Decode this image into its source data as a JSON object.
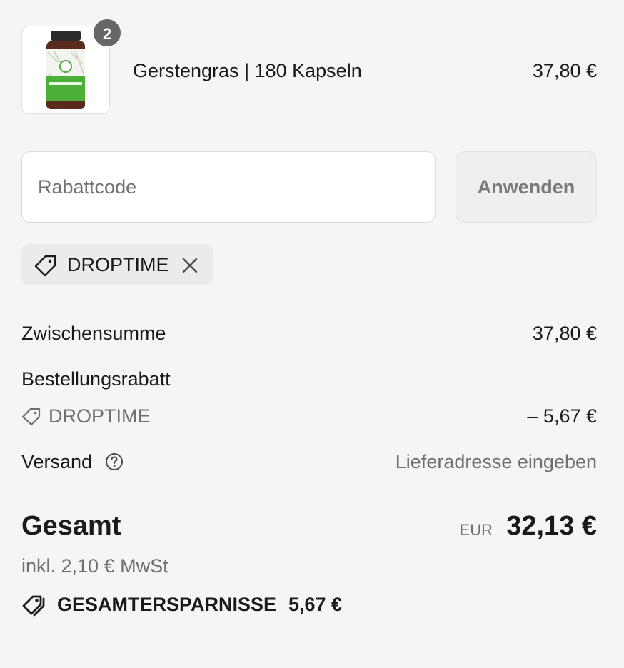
{
  "product": {
    "quantity": "2",
    "name": "Gerstengras | 180 Kapseln",
    "price": "37,80 €"
  },
  "discount": {
    "placeholder": "Rabattcode",
    "apply_label": "Anwenden",
    "applied_code": "DROPTIME"
  },
  "summary": {
    "subtotal_label": "Zwischensumme",
    "subtotal_value": "37,80 €",
    "order_discount_label": "Bestellungsrabatt",
    "order_discount_code": "DROPTIME",
    "order_discount_value": "– 5,67 €",
    "shipping_label": "Versand",
    "shipping_value": "Lieferadresse eingeben",
    "total_label": "Gesamt",
    "total_currency": "EUR",
    "total_value": "32,13 €",
    "tax_note": "inkl. 2,10 € MwSt",
    "savings_label": "GESAMTERSPARNISSE",
    "savings_value": "5,67 €"
  },
  "icons": {
    "tag": "tag-icon",
    "close": "close-icon",
    "help": "question-circle-icon",
    "savings": "tags-icon"
  },
  "colors": {
    "background": "#f5f5f5",
    "badge": "#666666",
    "muted_text": "#6f6f6f",
    "bottle_green": "#4caf3a"
  }
}
